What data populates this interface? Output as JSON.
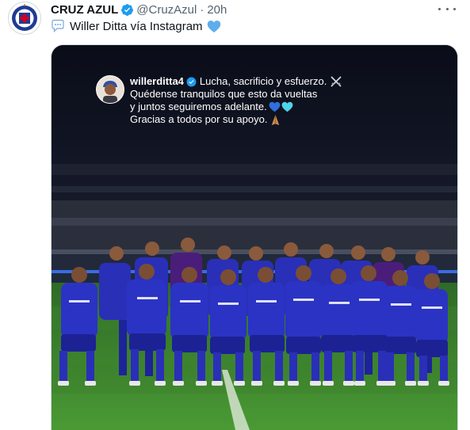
{
  "tweet": {
    "author_name": "CRUZ AZUL",
    "handle": "@CruzAzul",
    "separator": "·",
    "time": "20h",
    "text": "Willer Ditta vía Instagram",
    "prefix_icon": "speech-balloon-icon",
    "suffix_icon": "blue-heart-icon"
  },
  "instagram_post": {
    "username": "willerditta4",
    "line1": "Lucha, sacrificio y esfuerzo.",
    "line2": "Quédense tranquilos que esto da vueltas",
    "line3": "y juntos seguiremos adelante.",
    "line4": "Gracias a todos por su apoyo.",
    "emojis": [
      "crossed-swords-icon",
      "blue-heart-icon",
      "light-blue-heart-icon",
      "praying-hands-icon"
    ]
  },
  "colors": {
    "verified_blue": "#1d9bf0",
    "kit_blue": "#2a2fb8",
    "pitch_green": "#3f8a2e",
    "text_secondary": "#536471"
  }
}
